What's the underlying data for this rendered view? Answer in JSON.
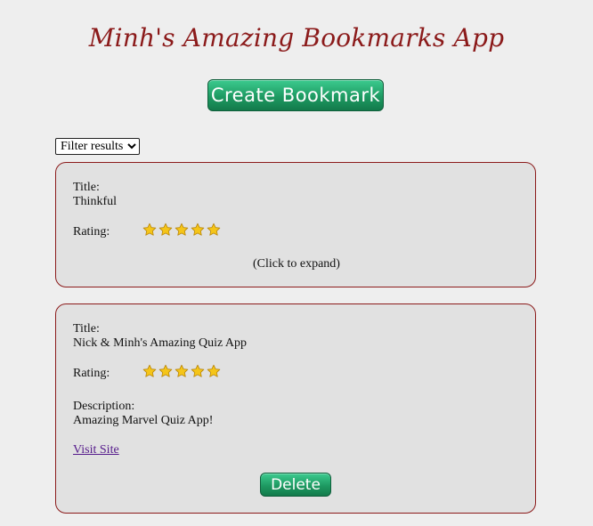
{
  "header": {
    "title": "Minh's Amazing Bookmarks App",
    "create_button_label": "Create Bookmark"
  },
  "filter": {
    "selected": "Filter results"
  },
  "bookmarks": [
    {
      "title_label": "Title:",
      "title": "Thinkful",
      "rating_label": "Rating:",
      "rating": 5,
      "rating_max": 5,
      "expand_hint": "(Click to expand)"
    },
    {
      "title_label": "Title:",
      "title": "Nick & Minh's Amazing Quiz App",
      "rating_label": "Rating:",
      "rating": 5,
      "rating_max": 5,
      "description_label": "Description:",
      "description": "Amazing Marvel Quiz App!",
      "visit_label": "Visit Site",
      "delete_label": "Delete"
    }
  ],
  "colors": {
    "title": "#8b1a1a",
    "card_border": "#8b1a1a",
    "button_green": "#1e9a62",
    "star_gold": "#f5c518",
    "link": "#551a8b"
  },
  "icons": {
    "star": "star-icon",
    "dropdown": "chevron-down-icon"
  }
}
